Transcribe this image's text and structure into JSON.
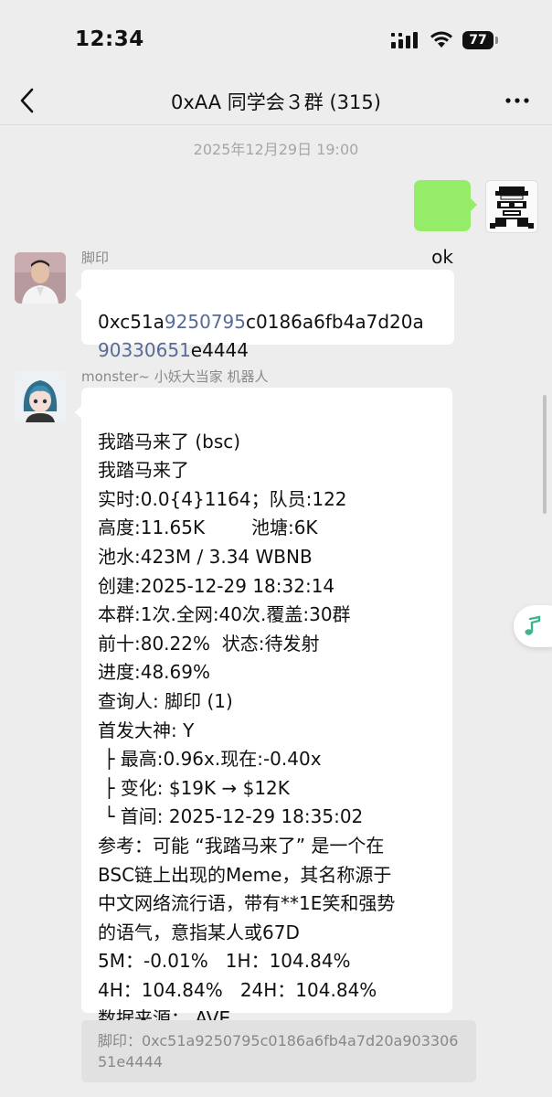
{
  "status_bar": {
    "time": "12:34",
    "battery": "77"
  },
  "nav": {
    "title": "0xAA 同学会３群 (315)",
    "back_icon": "chevron-left-icon",
    "more_icon": "more-dots-icon"
  },
  "timestamp": "2025年12月29日 19:00",
  "messages": {
    "self": {
      "text": "ok"
    },
    "jiaoyin": {
      "name": "脚印",
      "addr_parts": [
        "0xc51a",
        "9250795",
        "c0186a6fb4a7d20a",
        "90330651",
        "e4444"
      ]
    },
    "bot": {
      "name": "monster~ 小妖大当家 机器人",
      "lines": [
        "我踏马来了 (bsc)",
        "我踏马来了",
        "实时:0.0{4}1164；队员:122",
        "高度:11.65K        池塘:6K",
        "池水:423M / 3.34 WBNB",
        "创建:2025-12-29 18:32:14",
        "本群:1次.全网:40次.覆盖:30群",
        "前十:80.22%  状态:待发射",
        "进度:48.69%",
        "查询人: 脚印 (1)",
        "首发大神: Y",
        " ├ 最高:0.96x.现在:-0.40x",
        " ├ 变化: $19K → $12K",
        " └ 首间: 2025-12-29 18:35:02",
        "参考：可能 “我踏马来了” 是一个在",
        "BSC链上出现的Meme，其名称源于",
        "中文网络流行语，带有**1E笑和强势",
        "的语气，意指某人或67D",
        "5M：-0.01%   1H：104.84%",
        "4H：104.84%   24H：104.84%",
        "数据来源： AVE"
      ]
    },
    "quote": {
      "text": "脚印：0xc51a9250795c0186a6fb4a7d20a90330651e4444"
    }
  },
  "colors": {
    "self_bubble": "#95ec69",
    "background": "#ededed",
    "link": "#576b95"
  },
  "music_icon": "music-note-icon"
}
